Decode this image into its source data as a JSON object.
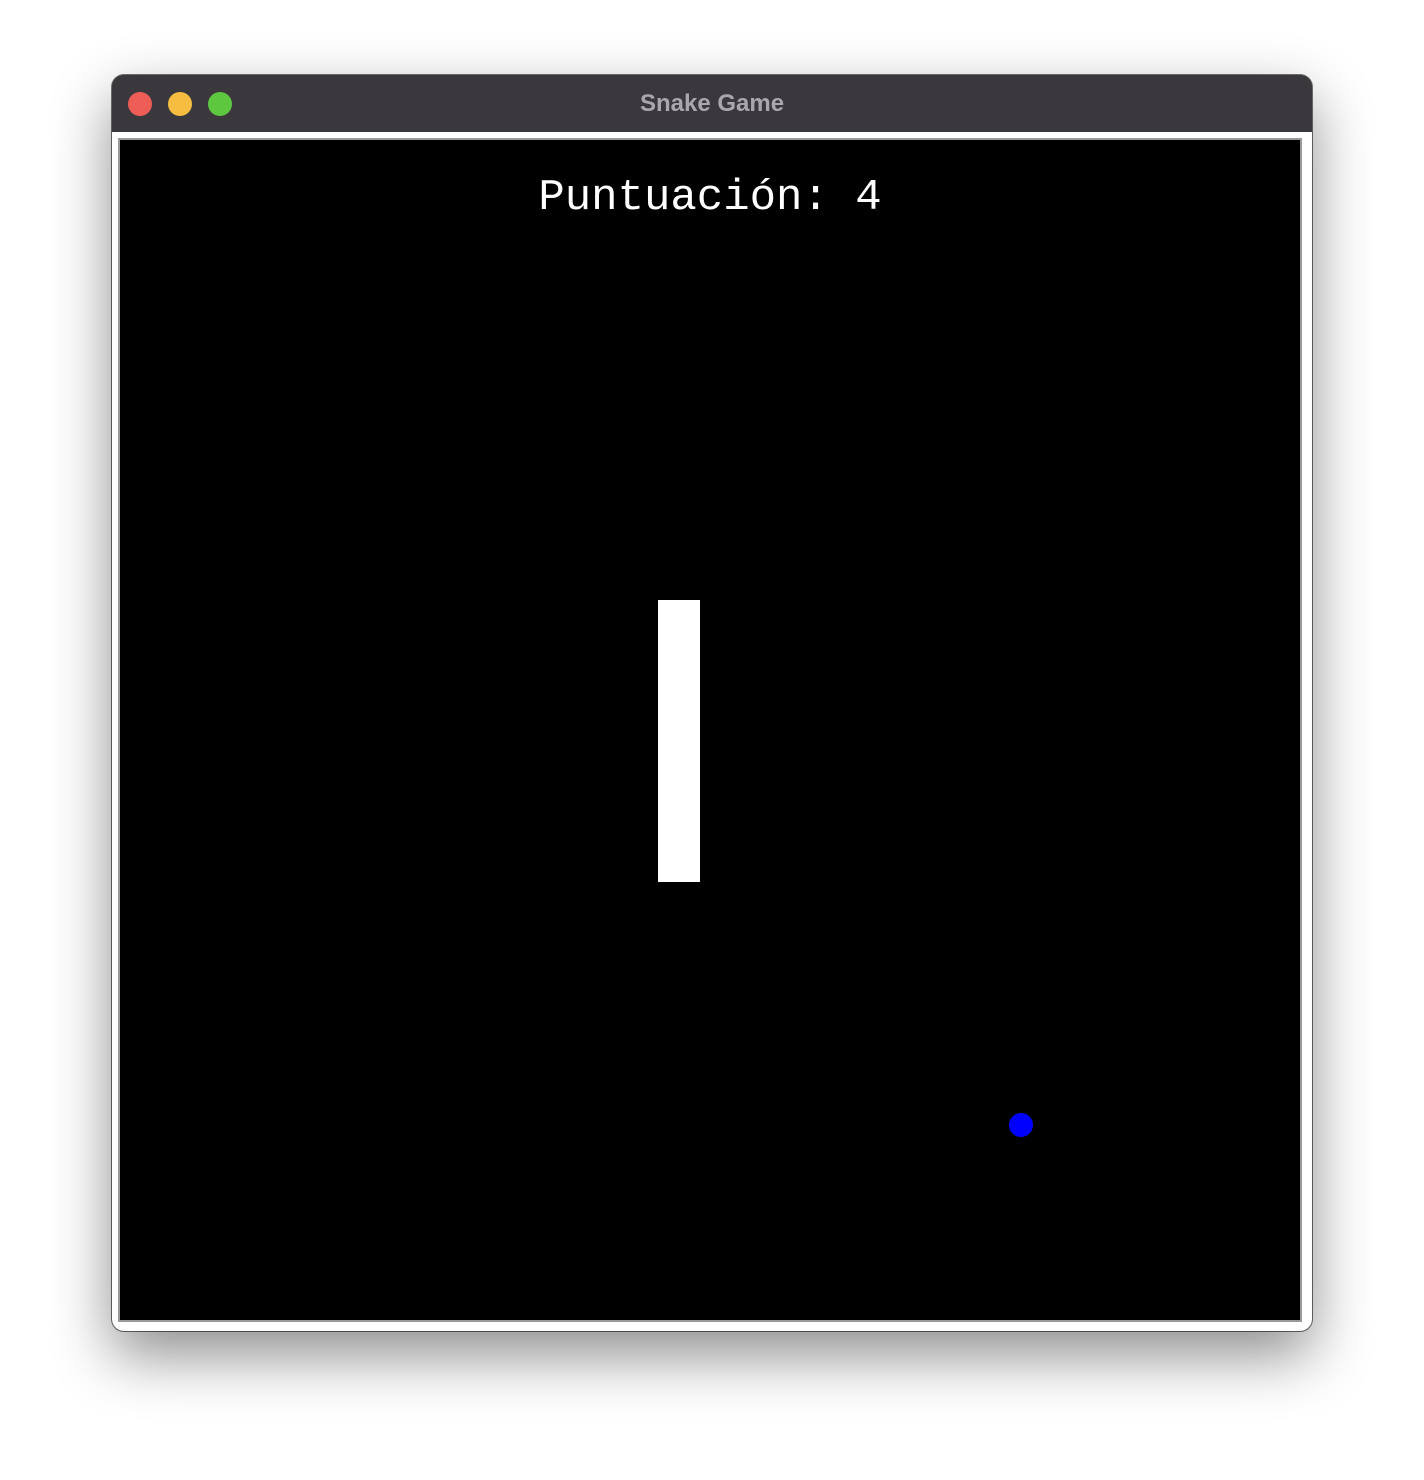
{
  "window": {
    "title": "Snake Game",
    "controls": {
      "close_color": "#ee5e57",
      "minimize_color": "#f6bd40",
      "zoom_color": "#5cc73f"
    }
  },
  "game": {
    "score_label": "Puntuación:",
    "score_value": "4",
    "background_color": "#000000",
    "snake_color": "#ffffff",
    "food_color": "#0000ff"
  }
}
